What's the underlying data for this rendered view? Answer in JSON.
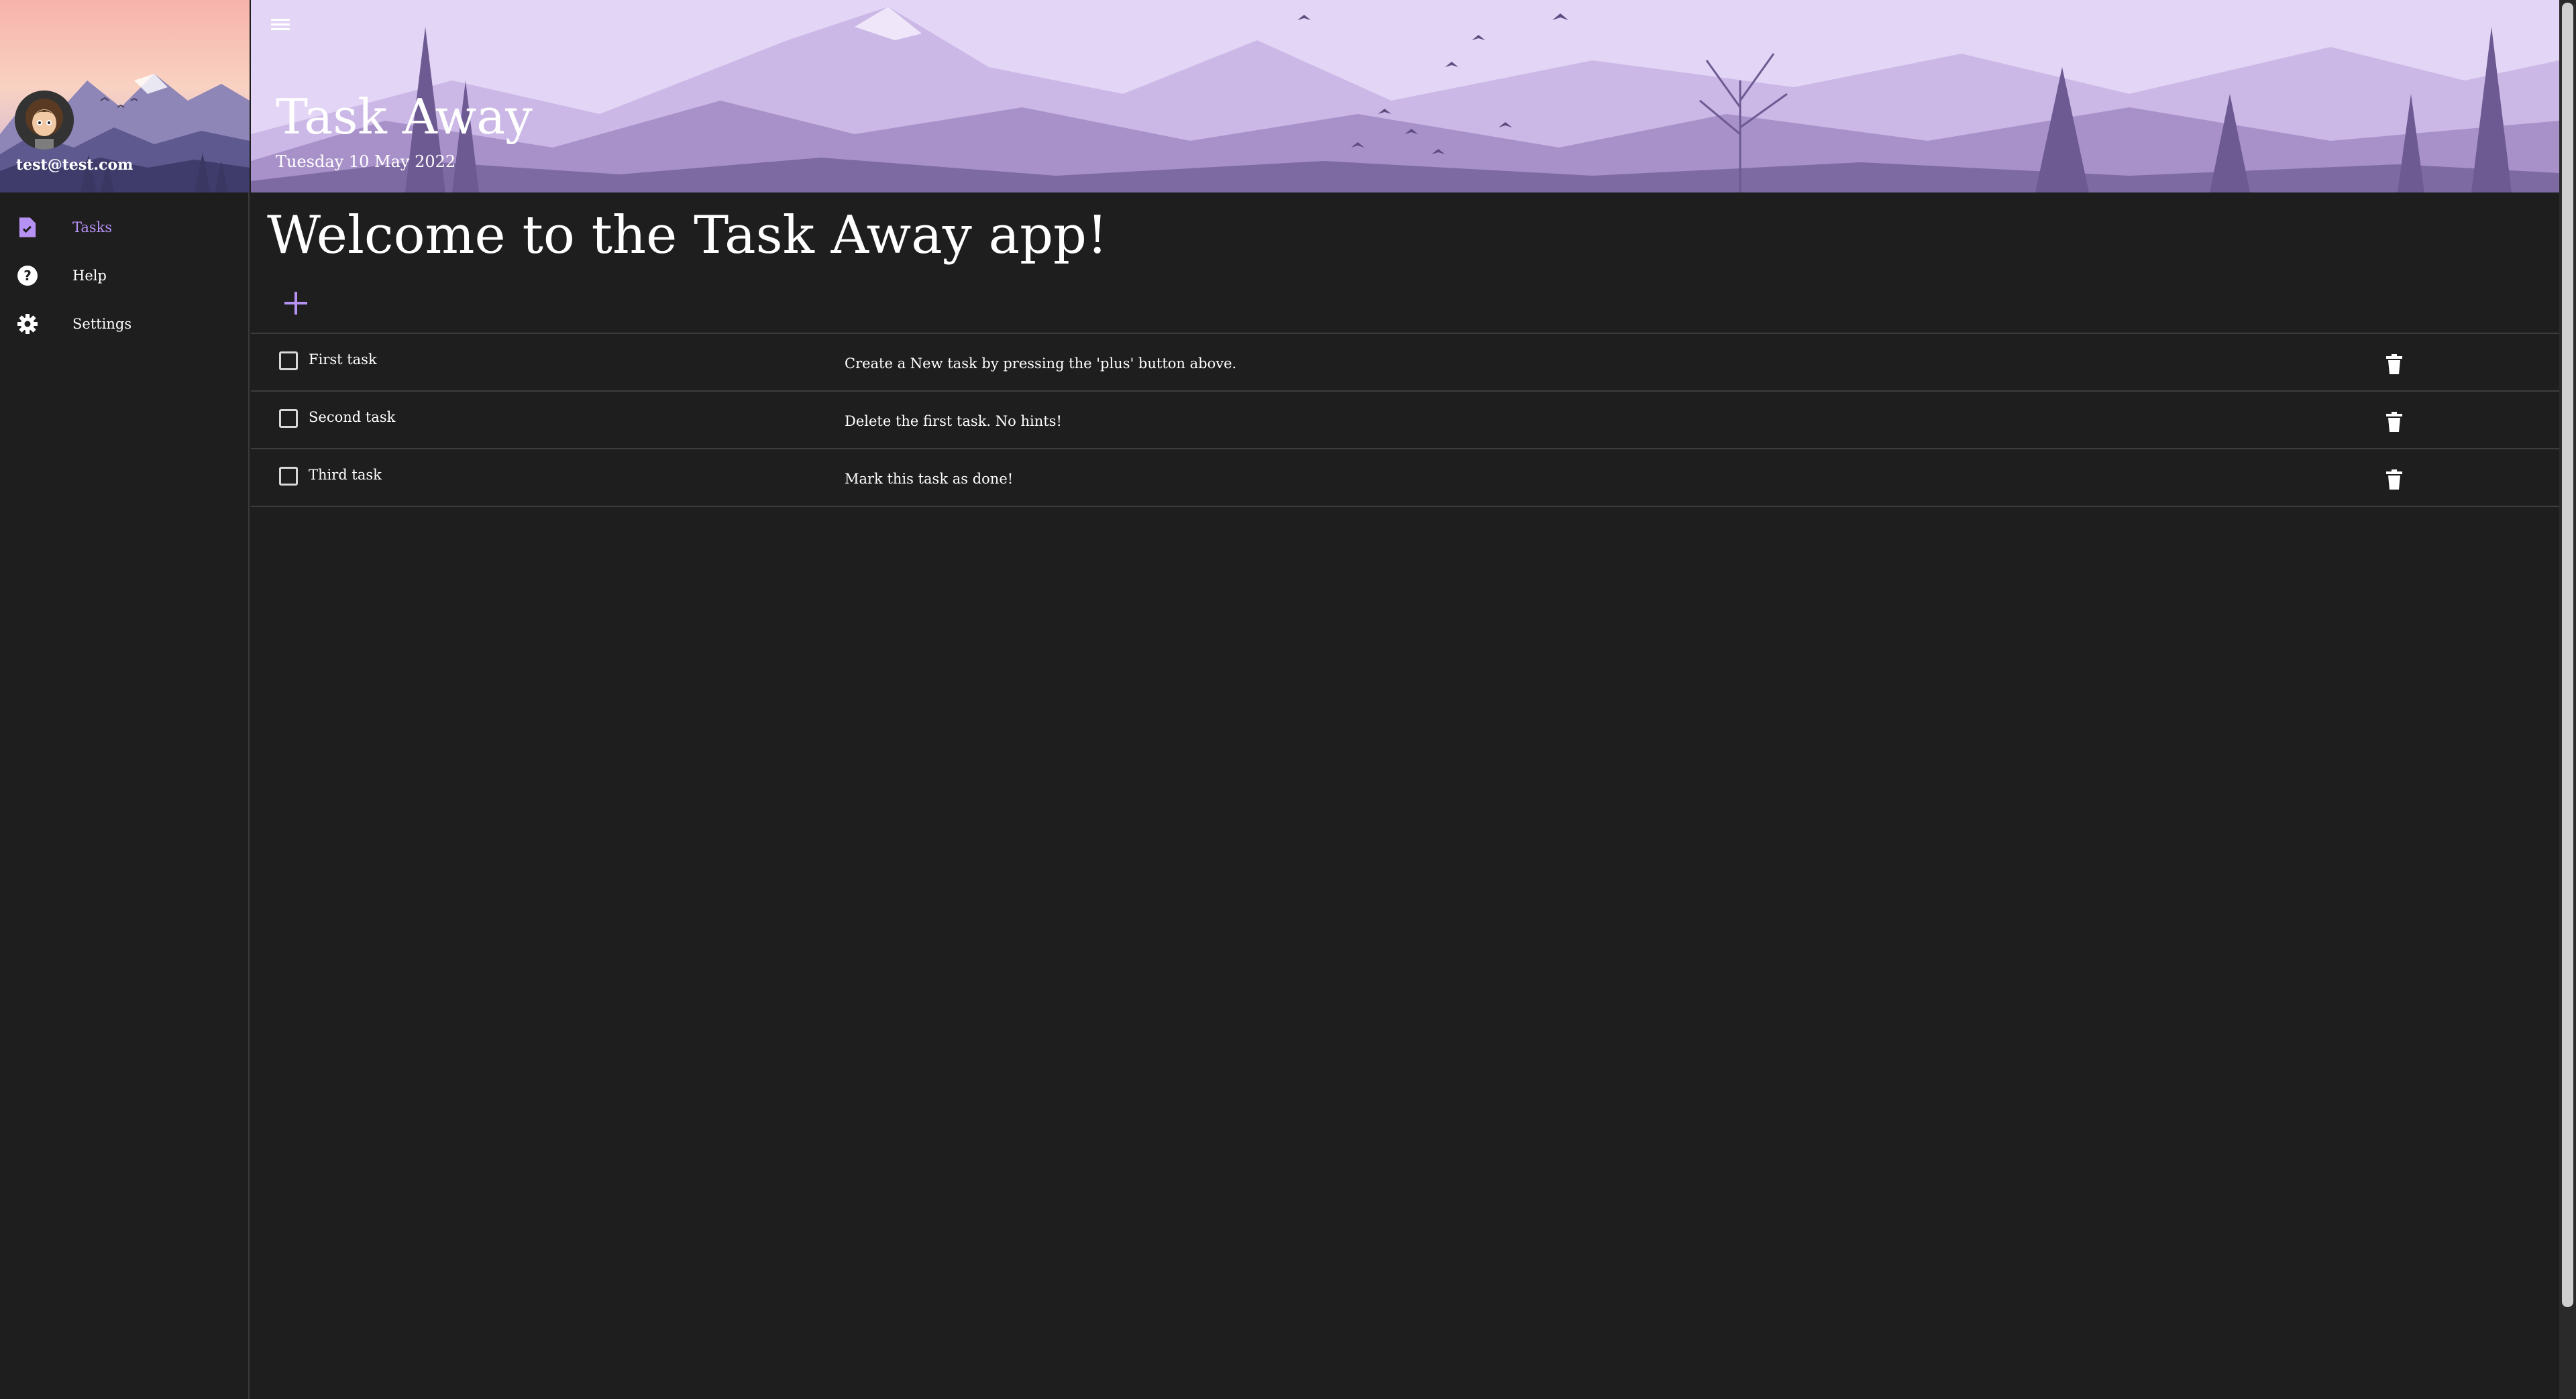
{
  "app": {
    "title": "Task Away",
    "date": "Tuesday 10 May 2022",
    "accent_color": "#b792f5",
    "background_color": "#1e1e1e"
  },
  "sidebar": {
    "user_email": "test@test.com",
    "items": [
      {
        "label": "Tasks",
        "icon": "task-icon",
        "active": true
      },
      {
        "label": "Help",
        "icon": "help-icon",
        "active": false
      },
      {
        "label": "Settings",
        "icon": "gear-icon",
        "active": false
      }
    ]
  },
  "header": {
    "menu_icon": "menu-icon"
  },
  "main": {
    "welcome": "Welcome to the Task Away app!",
    "add_icon": "plus-icon",
    "tasks": [
      {
        "title": "First task",
        "description": "Create a New task by pressing the 'plus' button above.",
        "done": false
      },
      {
        "title": "Second task",
        "description": "Delete the first task. No hints!",
        "done": false
      },
      {
        "title": "Third task",
        "description": "Mark this task as done!",
        "done": false
      }
    ]
  }
}
